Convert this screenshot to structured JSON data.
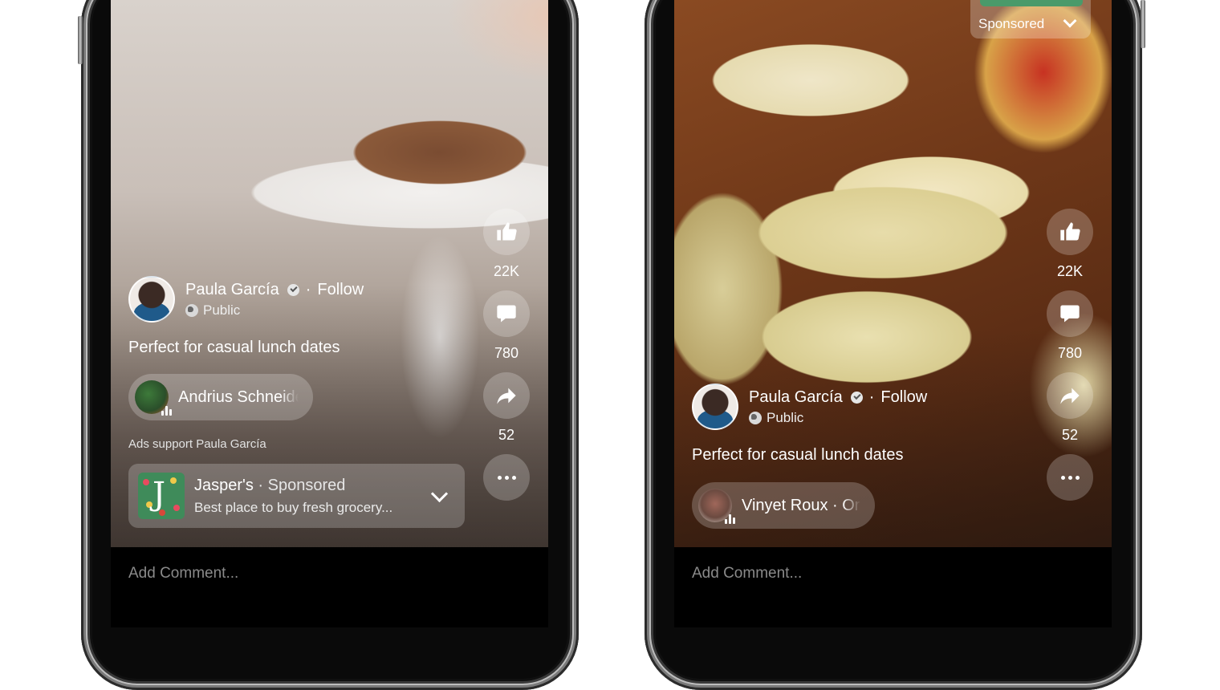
{
  "phones": [
    {
      "id": "left",
      "author": {
        "name": "Paula García",
        "follow": "Follow",
        "separator": "·",
        "privacy": "Public",
        "verified": true
      },
      "caption": "Perfect for casual lunch dates",
      "audio": {
        "name": "Andrius Schneider"
      },
      "ads_support": "Ads support Paula García",
      "ad": {
        "brand": "Jasper's",
        "separator": "·",
        "sponsored": "Sponsored",
        "description": "Best place to buy fresh grocery..."
      },
      "actions": [
        {
          "icon": "thumbs-up-icon",
          "label": "Like",
          "count": "22K"
        },
        {
          "icon": "comment-icon",
          "label": "Comment",
          "count": "780"
        },
        {
          "icon": "share-icon",
          "label": "Share",
          "count": "52"
        },
        {
          "icon": "more-icon",
          "label": "More",
          "count": ""
        }
      ],
      "comment_placeholder": "Add Comment..."
    },
    {
      "id": "right",
      "sponsored_tag": "Sponsored",
      "author": {
        "name": "Paula García",
        "follow": "Follow",
        "separator": "·",
        "privacy": "Public",
        "verified": true
      },
      "caption": "Perfect for casual lunch dates",
      "audio": {
        "name": "Vinyet Roux · Original audio"
      },
      "actions": [
        {
          "icon": "thumbs-up-icon",
          "label": "Like",
          "count": "22K"
        },
        {
          "icon": "comment-icon",
          "label": "Comment",
          "count": "780"
        },
        {
          "icon": "share-icon",
          "label": "Share",
          "count": "52"
        },
        {
          "icon": "more-icon",
          "label": "More",
          "count": ""
        }
      ],
      "comment_placeholder": "Add Comment..."
    }
  ],
  "colors": {
    "overlay": "#ffffff38",
    "text": "#ffffff",
    "comment_text": "#8a8a8a",
    "ad_logo": "#3f8b5a"
  }
}
